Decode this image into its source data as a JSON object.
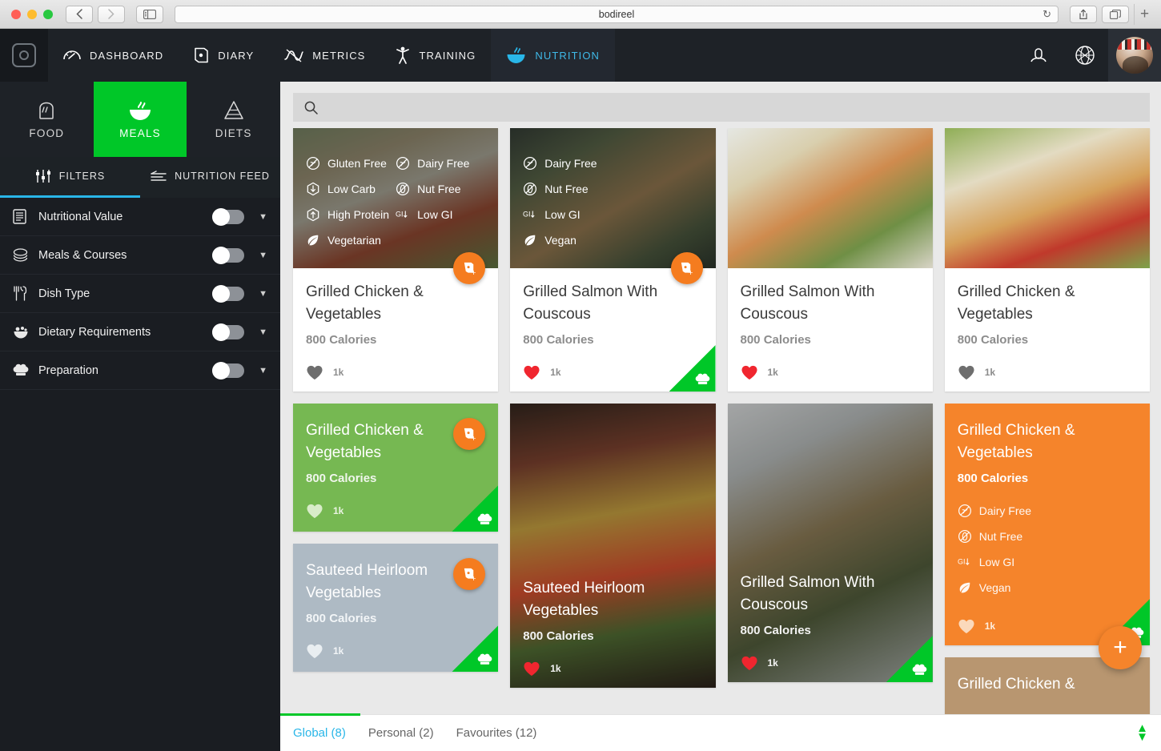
{
  "browser": {
    "title": "bodireel",
    "back_icon": "chevron-left-icon",
    "forward_icon": "chevron-right-icon",
    "sidebar_icon": "sidebar-toggle-icon",
    "reload_icon": "reload-icon",
    "share_icon": "share-icon",
    "tabs_icon": "tab-overview-icon",
    "newtab_label": "+"
  },
  "nav": {
    "logo": "bodireel-logo",
    "items": [
      {
        "label": "DASHBOARD",
        "icon": "gauge-icon",
        "active": false
      },
      {
        "label": "DIARY",
        "icon": "book-icon",
        "active": false
      },
      {
        "label": "METRICS",
        "icon": "line-chart-icon",
        "active": false
      },
      {
        "label": "TRAINING",
        "icon": "person-icon",
        "active": false
      },
      {
        "label": "NUTRITION",
        "icon": "bowl-icon",
        "active": true
      }
    ],
    "right_icons": [
      "friends-icon",
      "globe-icon"
    ],
    "avatar": "user-avatar"
  },
  "sidebar": {
    "category_tabs": [
      {
        "label": "FOOD",
        "icon": "bread-icon",
        "active": false
      },
      {
        "label": "MEALS",
        "icon": "bowl-icon",
        "active": true
      },
      {
        "label": "DIETS",
        "icon": "pyramid-icon",
        "active": false
      }
    ],
    "sub_tabs": [
      {
        "label": "FILTERS",
        "icon": "sliders-icon",
        "active": true
      },
      {
        "label": "NUTRITION FEED",
        "icon": "feed-icon",
        "active": false
      }
    ],
    "filters": [
      {
        "label": "Nutritional Value",
        "icon": "list-document-icon",
        "enabled": false
      },
      {
        "label": "Meals & Courses",
        "icon": "stacked-plates-icon",
        "enabled": false
      },
      {
        "label": "Dish Type",
        "icon": "cutlery-icon",
        "enabled": false
      },
      {
        "label": "Dietary Requirements",
        "icon": "salad-bowl-icon",
        "enabled": false
      },
      {
        "label": "Preparation",
        "icon": "chef-hat-icon",
        "enabled": false
      }
    ]
  },
  "search": {
    "value": "",
    "placeholder": "",
    "icon": "search-icon"
  },
  "cards": {
    "c1": {
      "title": "Grilled Chicken & Vegetables",
      "calories": "800 Calories",
      "likes": "1k",
      "tags": [
        "Gluten Free",
        "Dairy Free",
        "Low Carb",
        "Nut Free",
        "High Protein",
        "Low GI",
        "Vegetarian"
      ]
    },
    "c2": {
      "title": "Grilled Salmon With Couscous",
      "calories": "800 Calories",
      "likes": "1k",
      "tags": [
        "Dairy Free",
        "Nut Free",
        "Low GI",
        "Vegan"
      ]
    },
    "c3": {
      "title": "Grilled Salmon With Couscous",
      "calories": "800 Calories",
      "likes": "1k"
    },
    "c4": {
      "title": "Grilled Chicken & Vegetables",
      "calories": "800 Calories",
      "likes": "1k"
    },
    "c5": {
      "title": "Grilled Chicken & Vegetables",
      "calories": "800 Calories",
      "likes": "1k"
    },
    "c6": {
      "title": "Sauteed Heirloom Vegetables",
      "calories": "800 Calories",
      "likes": "1k"
    },
    "c7": {
      "title": "Sauteed Heirloom Vegetables",
      "calories": "800 Calories",
      "likes": "1k"
    },
    "c8": {
      "title": "Grilled Salmon With Couscous",
      "calories": "800 Calories",
      "likes": "1k"
    },
    "c9": {
      "title": "Grilled Chicken & Vegetables",
      "calories": "800 Calories",
      "likes": "1k",
      "tags": [
        "Dairy Free",
        "Nut Free",
        "Low GI",
        "Vegan"
      ]
    },
    "c10": {
      "title": "Grilled Chicken &"
    }
  },
  "footer": {
    "tabs": [
      {
        "label": "Global (8)",
        "active": true
      },
      {
        "label": "Personal (2)",
        "active": false
      },
      {
        "label": "Favourites (12)",
        "active": false
      }
    ],
    "scroll_icon": "scroll-up-down-icon"
  },
  "fab": {
    "label": "+",
    "icon": "add-icon"
  },
  "colors": {
    "accent_green": "#00C728",
    "accent_cyan": "#29B6E8",
    "accent_orange": "#F5842B",
    "nav_dark": "#1E2227",
    "like_red": "#F0262F"
  }
}
